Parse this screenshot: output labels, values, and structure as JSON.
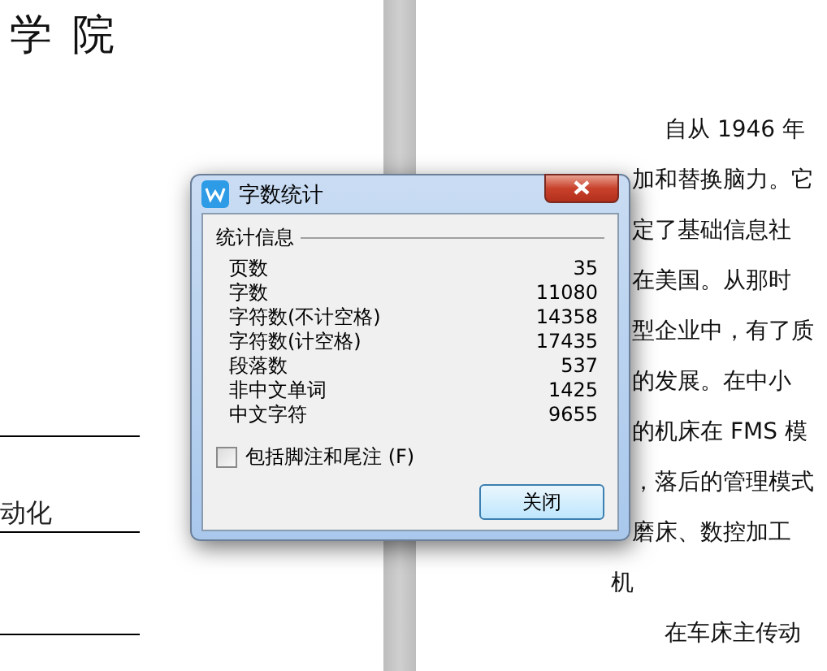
{
  "left_page": {
    "heading": "学 院",
    "underlined_text": "动化"
  },
  "right_page": {
    "lines": [
      {
        "text": "自从 1946 年",
        "kind": "indent"
      },
      {
        "text": "加和替换脑力。它",
        "kind": "plain"
      },
      {
        "text": "定了基础信息社",
        "kind": "plain"
      },
      {
        "text": "在美国。从那时",
        "kind": "plain"
      },
      {
        "text": "型企业中，有了质",
        "kind": "plain"
      },
      {
        "text": "的发展。在中小",
        "kind": "plain"
      },
      {
        "text": "的机床在 FMS 模",
        "kind": "plain"
      },
      {
        "text": "，落后的管理模式",
        "kind": "plain"
      },
      {
        "text": "磨床、数控加工",
        "kind": "plain"
      },
      {
        "text": "机",
        "kind": "outdent"
      },
      {
        "text": "在车床主传动",
        "kind": "indent"
      }
    ]
  },
  "dialog": {
    "title": "字数统计",
    "group": "统计信息",
    "stats": [
      {
        "label": "页数",
        "value": "35"
      },
      {
        "label": "字数",
        "value": "11080"
      },
      {
        "label": "字符数(不计空格)",
        "value": "14358"
      },
      {
        "label": "字符数(计空格)",
        "value": "17435"
      },
      {
        "label": "段落数",
        "value": "537"
      },
      {
        "label": "非中文单词",
        "value": "1425"
      },
      {
        "label": "中文字符",
        "value": "9655"
      }
    ],
    "checkbox": {
      "label": "包括脚注和尾注 (F)",
      "checked": false
    },
    "button": "关闭"
  }
}
